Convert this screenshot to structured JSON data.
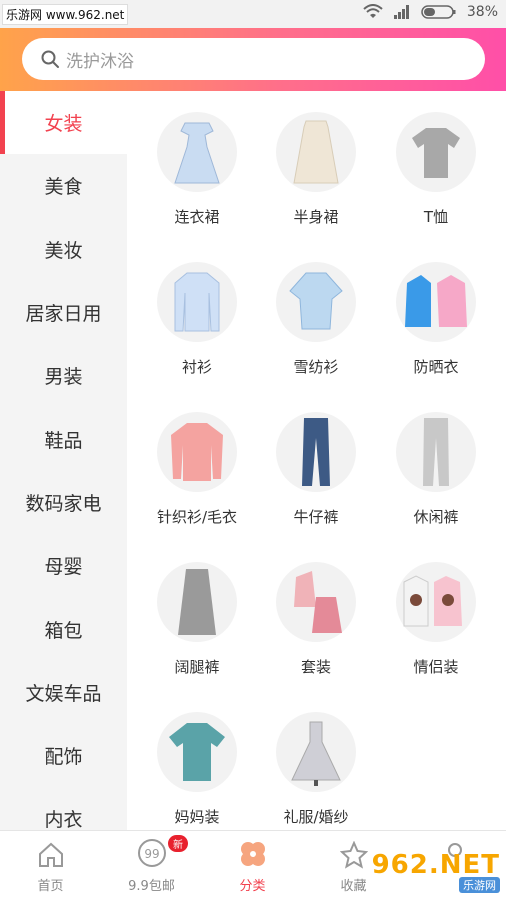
{
  "status_bar": {
    "watermark": "乐游网 www.962.net",
    "battery": "38%"
  },
  "search": {
    "placeholder": "洗护沐浴"
  },
  "sidebar": {
    "items": [
      {
        "label": "女装"
      },
      {
        "label": "美食"
      },
      {
        "label": "美妆"
      },
      {
        "label": "居家日用"
      },
      {
        "label": "男装"
      },
      {
        "label": "鞋品"
      },
      {
        "label": "数码家电"
      },
      {
        "label": "母婴"
      },
      {
        "label": "箱包"
      },
      {
        "label": "文娱车品"
      },
      {
        "label": "配饰"
      },
      {
        "label": "内衣"
      }
    ]
  },
  "grid": {
    "items": [
      {
        "label": "连衣裙"
      },
      {
        "label": "半身裙"
      },
      {
        "label": "T恤"
      },
      {
        "label": "衬衫"
      },
      {
        "label": "雪纺衫"
      },
      {
        "label": "防晒衣"
      },
      {
        "label": "针织衫/毛衣"
      },
      {
        "label": "牛仔裤"
      },
      {
        "label": "休闲裤"
      },
      {
        "label": "阔腿裤"
      },
      {
        "label": "套装"
      },
      {
        "label": "情侣装"
      },
      {
        "label": "妈妈装"
      },
      {
        "label": "礼服/婚纱"
      }
    ]
  },
  "bottom_nav": {
    "tabs": [
      {
        "label": "首页"
      },
      {
        "label": "9.9包邮"
      },
      {
        "label": "分类"
      },
      {
        "label": "收藏"
      },
      {
        "label": ""
      }
    ],
    "badge": "新"
  },
  "watermark": {
    "big": "962.NET",
    "small": "乐游网"
  }
}
